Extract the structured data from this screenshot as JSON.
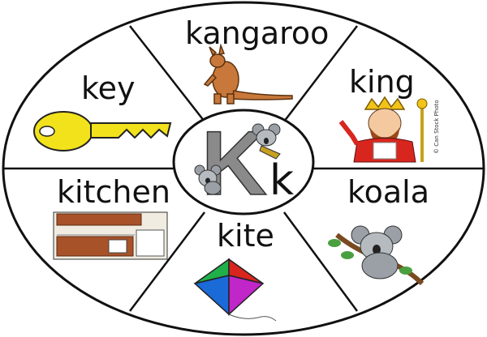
{
  "center": {
    "upper": "K",
    "lower": "k"
  },
  "segments": [
    {
      "word": "kangaroo",
      "picture": "kangaroo-picture"
    },
    {
      "word": "king",
      "picture": "king-picture"
    },
    {
      "word": "koala",
      "picture": "koala-picture"
    },
    {
      "word": "kite",
      "picture": "kite-picture"
    },
    {
      "word": "kitchen",
      "picture": "kitchen-picture"
    },
    {
      "word": "key",
      "picture": "key-picture"
    }
  ],
  "watermark": "© Can Stock Photo",
  "colors": {
    "outline": "#111111",
    "key": "#f2e21c",
    "kangaroo": "#c8783a",
    "king_robe": "#d8261f",
    "crown": "#f2c318",
    "koala": "#9aa0a6",
    "kitchen_wood": "#a8522a",
    "letter_K": "#8a8a8a"
  }
}
